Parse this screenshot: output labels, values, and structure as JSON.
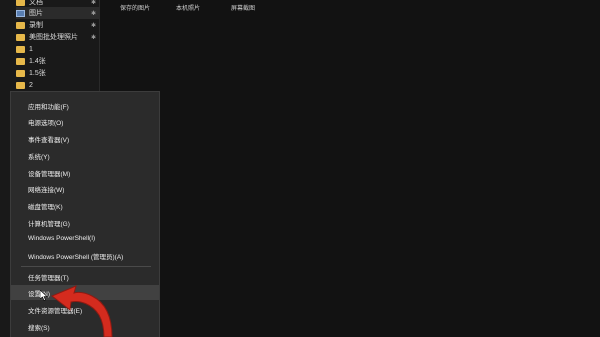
{
  "nav": {
    "items": [
      {
        "label": "文档",
        "icon": "folder-icon",
        "pinned": true
      },
      {
        "label": "图片",
        "icon": "pictures-icon",
        "pinned": true
      },
      {
        "label": "录制",
        "icon": "folder-icon",
        "pinned": true
      },
      {
        "label": "美图批处理照片",
        "icon": "folder-icon",
        "pinned": true
      },
      {
        "label": "1",
        "icon": "folder-icon",
        "pinned": false
      },
      {
        "label": "1.4张",
        "icon": "folder-icon",
        "pinned": false
      },
      {
        "label": "1.5张",
        "icon": "folder-icon",
        "pinned": false
      },
      {
        "label": "2",
        "icon": "folder-icon",
        "pinned": false
      }
    ]
  },
  "columns": {
    "col1": "保存的图片",
    "col2": "本机照片",
    "col3": "屏幕截图"
  },
  "menu": {
    "group1": [
      "应用和功能(F)",
      "电源选项(O)",
      "事件查看器(V)",
      "系统(Y)",
      "设备管理器(M)",
      "网络连接(W)",
      "磁盘管理(K)",
      "计算机管理(G)",
      "Windows PowerShell(I)",
      "Windows PowerShell (管理员)(A)"
    ],
    "group2": [
      "任务管理器(T)",
      "设置(N)",
      "文件资源管理器(E)",
      "搜索(S)"
    ],
    "hovered_item": "设置(N)"
  },
  "colors": {
    "annotation_arrow": "#d42b1e",
    "menu_background": "#2b2b2b",
    "folder": "#e6b84a"
  }
}
